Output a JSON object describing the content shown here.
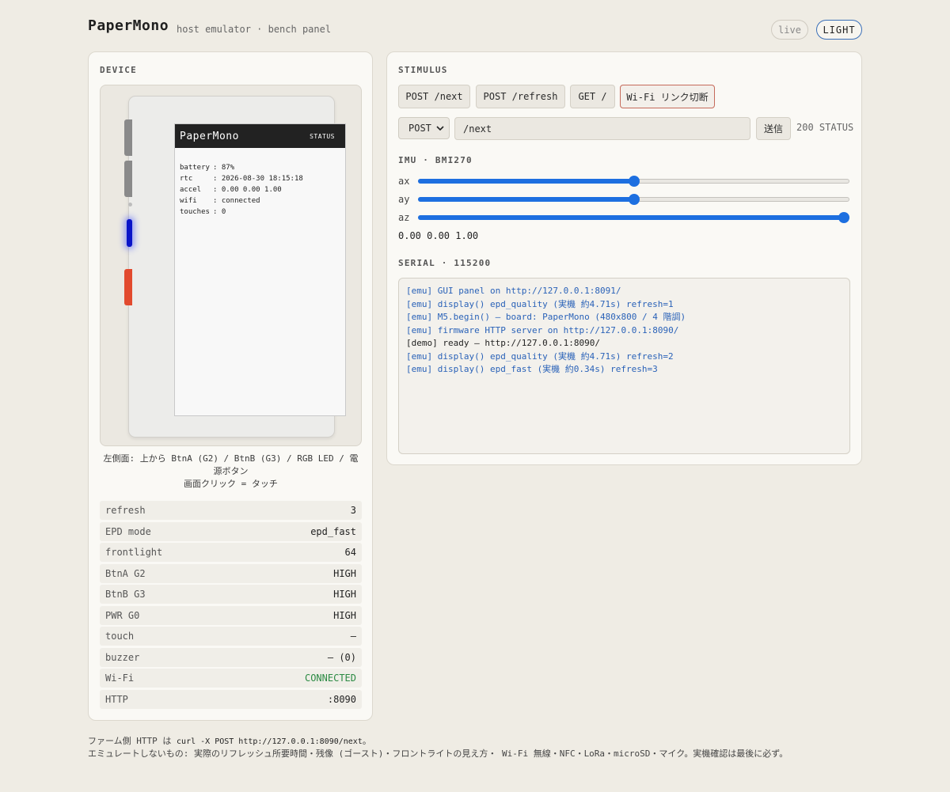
{
  "header": {
    "title": "PaperMono",
    "subtitle": "host emulator · bench panel",
    "live_label": "live",
    "theme_label": "LIGHT"
  },
  "device": {
    "panel_label": "DEVICE",
    "screen": {
      "brand": "PaperMono",
      "status_label": "STATUS",
      "lines": [
        {
          "key": "battery",
          "value": ": 87%"
        },
        {
          "key": "rtc",
          "value": ": 2026-08-30 18:15:18"
        },
        {
          "key": "accel",
          "value": ": 0.00 0.00 1.00"
        },
        {
          "key": "wifi",
          "value": ": connected"
        },
        {
          "key": "touches",
          "value": ": 0"
        }
      ]
    },
    "caption_line1": "左側面: 上から BtnA (G2) / BtnB (G3) / RGB LED / 電源ボタン",
    "caption_line2": "画面クリック = タッチ",
    "led_color": "#0a14c8",
    "power_button_color": "#e24a2e",
    "state": [
      {
        "key": "refresh",
        "value": "3"
      },
      {
        "key": "EPD mode",
        "value": "epd_fast"
      },
      {
        "key": "frontlight",
        "value": "64"
      },
      {
        "key": "BtnA G2",
        "value": "HIGH"
      },
      {
        "key": "BtnB G3",
        "value": "HIGH"
      },
      {
        "key": "PWR G0",
        "value": "HIGH"
      },
      {
        "key": "touch",
        "value": "—"
      },
      {
        "key": "buzzer",
        "value": "— (0)"
      },
      {
        "key": "Wi-Fi",
        "value": "CONNECTED"
      },
      {
        "key": "HTTP",
        "value": ":8090"
      }
    ]
  },
  "stimulus": {
    "panel_label": "STIMULUS",
    "quick_buttons": [
      "POST /next",
      "POST /refresh",
      "GET /",
      "Wi-Fi リンク切断"
    ],
    "method_value": "POST",
    "path_value": "/next",
    "send_label": "送信",
    "status_text": "200 STATUS",
    "imu_label": "IMU · BMI270",
    "imu": [
      {
        "axis": "ax",
        "value": 0.0,
        "fraction": 0.5
      },
      {
        "axis": "ay",
        "value": 0.0,
        "fraction": 0.5
      },
      {
        "axis": "az",
        "value": 1.0,
        "fraction": 1.0
      }
    ],
    "imu_readout": "0.00 0.00 1.00",
    "serial_label": "SERIAL · 115200",
    "serial_lines": [
      {
        "kind": "emu",
        "text": "[emu] GUI panel on http://127.0.0.1:8091/"
      },
      {
        "kind": "emu",
        "text": "[emu] display() epd_quality (実機 約4.71s) refresh=1"
      },
      {
        "kind": "emu",
        "text": "[emu] M5.begin() — board: PaperMono (480x800 / 4 階調)"
      },
      {
        "kind": "emu",
        "text": "[emu] firmware HTTP server on http://127.0.0.1:8090/"
      },
      {
        "kind": "demo",
        "text": "[demo] ready — http://127.0.0.1:8090/"
      },
      {
        "kind": "emu",
        "text": "[emu] display() epd_quality (実機 約4.71s) refresh=2"
      },
      {
        "kind": "emu",
        "text": "[emu] display() epd_fast (実機 約0.34s) refresh=3"
      }
    ]
  },
  "footer": {
    "line1_prefix": "ファーム側 HTTP は ",
    "line1_code": "curl -X POST http://127.0.0.1:8090/next",
    "line1_suffix": "。",
    "line2": "エミュレートしないもの: 実際のリフレッシュ所要時間・残像 (ゴースト)・フロントライトの見え方・ Wi-Fi 無線・NFC・LoRa・microSD・マイク。実機確認は最後に必ず。"
  },
  "colors": {
    "accent_blue": "#1d6fe0",
    "ok_green": "#2b8a43",
    "serial_emu": "#2a62b8",
    "danger_border": "#c56a5a"
  }
}
